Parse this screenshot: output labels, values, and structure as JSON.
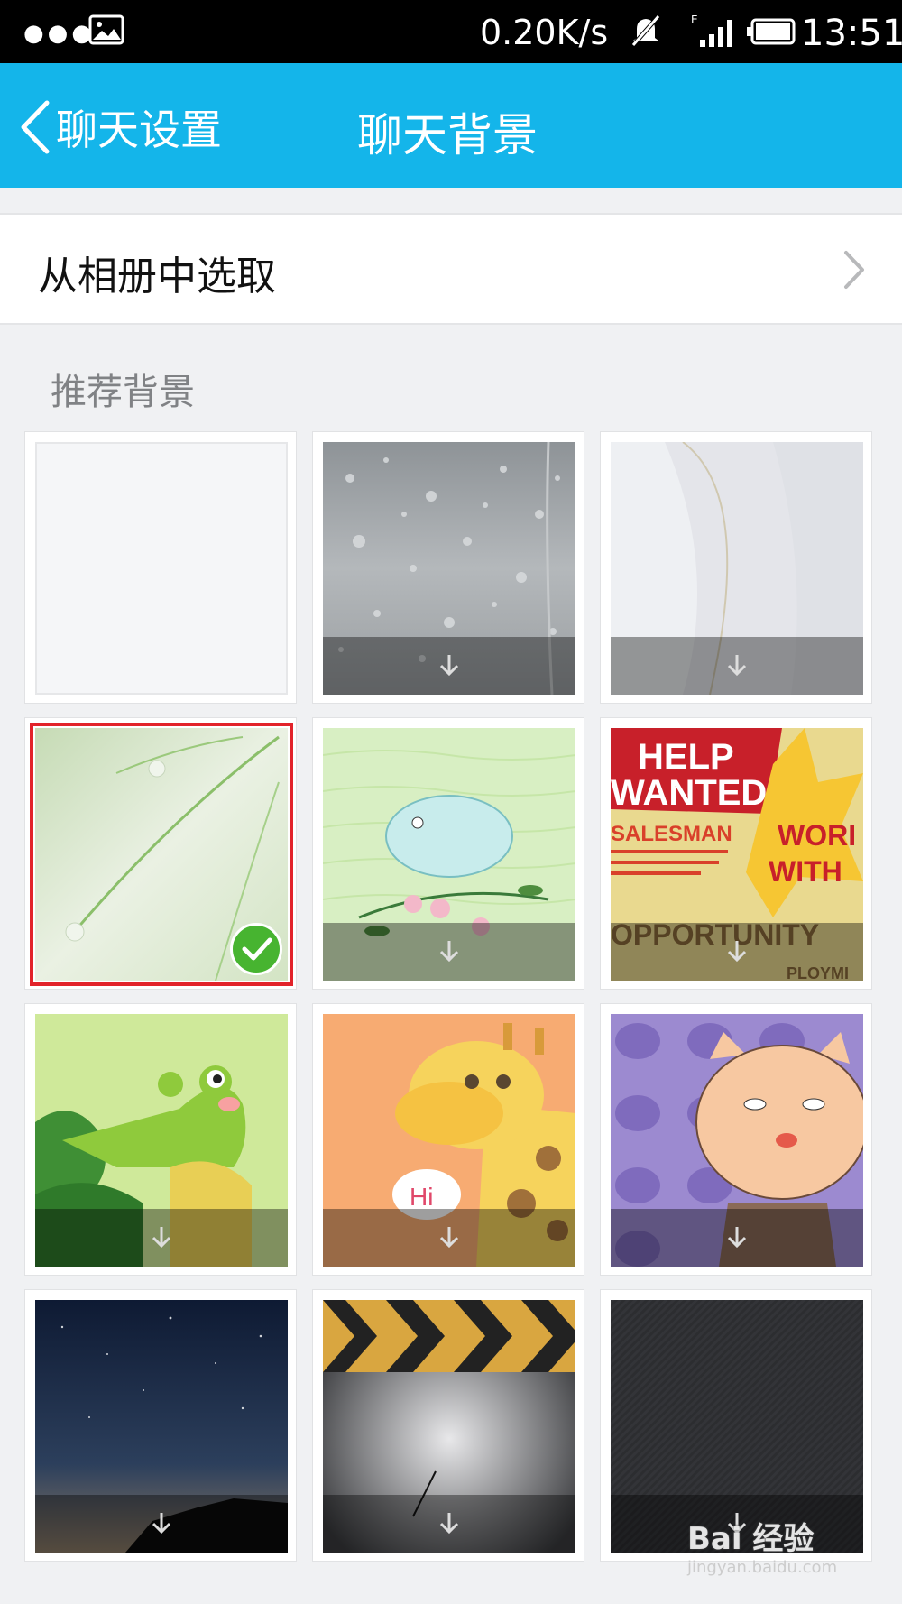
{
  "status_bar": {
    "network_speed": "0.20K/s",
    "network_type": "E",
    "time": "13:51",
    "icons": [
      "more-dots-icon",
      "gallery-icon",
      "mute-icon",
      "signal-icon",
      "battery-icon"
    ]
  },
  "header": {
    "back_label": "聊天设置",
    "title": "聊天背景",
    "color": "#14b5ea"
  },
  "album_row": {
    "label": "从相册中选取"
  },
  "section": {
    "title": "推荐背景"
  },
  "backgrounds": [
    {
      "name": "blank",
      "selected": false,
      "downloadable": false
    },
    {
      "name": "raindrops",
      "selected": false,
      "downloadable": true
    },
    {
      "name": "feather",
      "selected": false,
      "downloadable": true
    },
    {
      "name": "grass-dew",
      "selected": true,
      "downloadable": false
    },
    {
      "name": "bird-flowers",
      "selected": false,
      "downloadable": true
    },
    {
      "name": "help-wanted",
      "selected": false,
      "downloadable": true,
      "poster_text": {
        "line1": "HELP",
        "line2": "WANTED",
        "line3": "SALESMAN",
        "line4": "WORI",
        "line5": "WITH",
        "line6": "OPPORTUNITY",
        "line7": "PLOYMI"
      }
    },
    {
      "name": "crocodile",
      "selected": false,
      "downloadable": true
    },
    {
      "name": "giraffe",
      "selected": false,
      "downloadable": true,
      "bubble_text": "Hi"
    },
    {
      "name": "cat",
      "selected": false,
      "downloadable": true
    },
    {
      "name": "night-sky",
      "selected": false,
      "downloadable": true
    },
    {
      "name": "chevron-stage",
      "selected": false,
      "downloadable": true
    },
    {
      "name": "dark-texture",
      "selected": false,
      "downloadable": true
    }
  ],
  "selected_color": "#e2232a",
  "check_color": "#47b430",
  "watermark": {
    "main": "Bai 经验",
    "sub": "jingyan.baidu.com"
  }
}
